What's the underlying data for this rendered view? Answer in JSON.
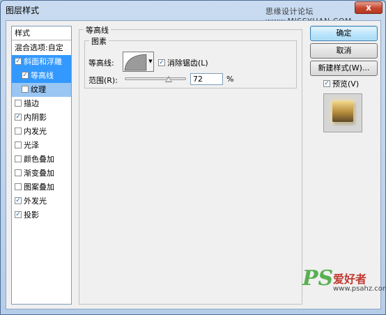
{
  "window": {
    "title": "图层样式",
    "watermark": "思缘设计论坛 www.MISSYUAN.COM",
    "close_label": "x"
  },
  "sidebar": {
    "header": "样式",
    "blend_options": "混合选项:自定",
    "items": [
      {
        "label": "斜面和浮雕",
        "checked": true,
        "selected": true
      },
      {
        "label": "等高线",
        "checked": true,
        "selected": true,
        "sub": true
      },
      {
        "label": "纹理",
        "checked": false,
        "sub": true
      },
      {
        "label": "描边",
        "checked": false
      },
      {
        "label": "内阴影",
        "checked": true
      },
      {
        "label": "内发光",
        "checked": false
      },
      {
        "label": "光泽",
        "checked": false
      },
      {
        "label": "颜色叠加",
        "checked": false
      },
      {
        "label": "渐变叠加",
        "checked": false
      },
      {
        "label": "图案叠加",
        "checked": false
      },
      {
        "label": "外发光",
        "checked": true
      },
      {
        "label": "投影",
        "checked": true
      }
    ]
  },
  "panel": {
    "title": "等高线",
    "subgroup_title": "图素",
    "contour_label": "等高线:",
    "antialias_label": "消除锯齿(L)",
    "antialias_checked": true,
    "range_label": "范围(R):",
    "range_value": "72",
    "range_unit": "%",
    "range_fraction": 0.72
  },
  "buttons": {
    "ok": "确定",
    "cancel": "取消",
    "new_style": "新建样式(W)...",
    "preview": "预览(V)",
    "preview_checked": true
  },
  "watermark_logo": {
    "ps": "PS",
    "cn": "爱好者",
    "url": "www.psahz.com"
  },
  "colors": {
    "selection": "#3399ff",
    "sub_selection": "#99c6f2",
    "title_bar": "#c9dbf0",
    "close_button": "#c5452d"
  }
}
